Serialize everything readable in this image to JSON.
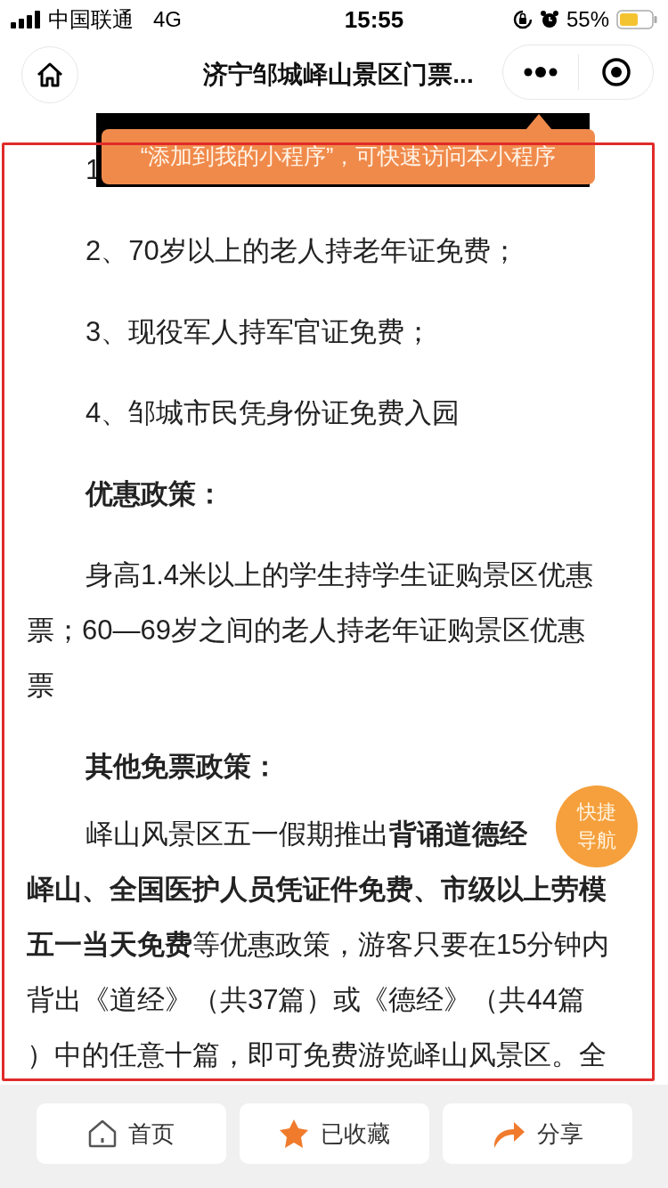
{
  "status_bar": {
    "carrier": "中国联通",
    "network": "4G",
    "time": "15:55",
    "battery": "55%"
  },
  "header": {
    "title": "济宁邹城峄山景区门票..."
  },
  "tooltip": {
    "text": "“添加到我的小程序”，可快速访问本小程序"
  },
  "content": [
    {
      "kind": "text",
      "text": "1"
    },
    {
      "kind": "text",
      "text": "2、70岁以上的老人持老年证免费；"
    },
    {
      "kind": "text",
      "text": "3、现役军人持军官证免费；"
    },
    {
      "kind": "text",
      "text": "4、邹城市民凭身份证免费入园"
    },
    {
      "kind": "heading",
      "text": "优惠政策："
    },
    {
      "kind": "lines",
      "lines": [
        "身高1.4米以上的学生持学生证购景区优惠",
        "票；60—69岁之间的老人持老年证购景区优惠",
        "票"
      ]
    },
    {
      "kind": "heading",
      "text": "其他免票政策："
    },
    {
      "kind": "lines",
      "lines": [
        "峄山风景区五一假期推出**背诵道德经**",
        "**峄山、全国医护人员凭证件免费、市级以上劳模**",
        "**五一当天免费**等优惠政策，游客只要在15分钟内",
        "背出《道经》（共37篇）或《德经》（共44篇",
        "）中的任意十篇，即可免费游览峄山风景区。全"
      ]
    }
  ],
  "float_button": {
    "label": "快捷导航"
  },
  "bottom_bar": [
    {
      "kind": "home",
      "label": "首页"
    },
    {
      "kind": "star",
      "label": "已收藏"
    },
    {
      "kind": "share",
      "label": "分享"
    }
  ]
}
